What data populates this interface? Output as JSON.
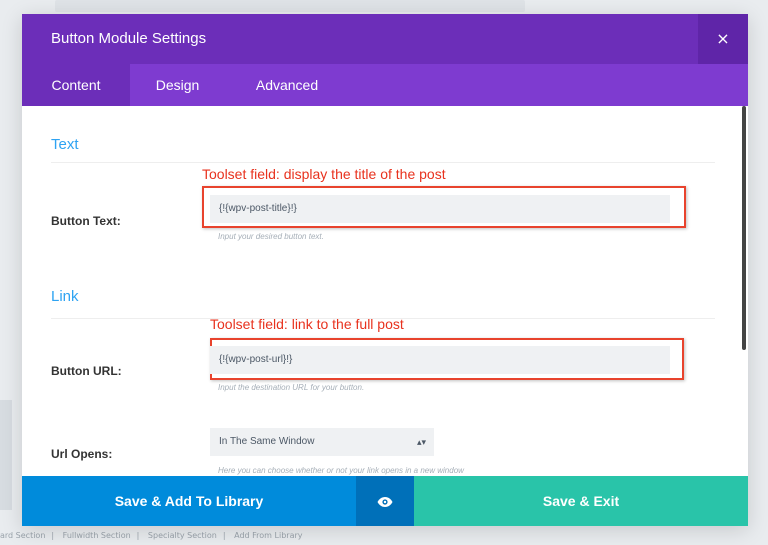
{
  "modal": {
    "title": "Button Module Settings",
    "close_symbol": "×",
    "tabs": [
      {
        "label": "Content",
        "active": true
      },
      {
        "label": "Design",
        "active": false
      },
      {
        "label": "Advanced",
        "active": false
      }
    ]
  },
  "text_section": {
    "title": "Text",
    "annotation": "Toolset field: display the title of the post",
    "button_text_label": "Button Text:",
    "button_text_value": "{!{wpv-post-title}!}",
    "button_text_hint": "Input your desired button text."
  },
  "link_section": {
    "title": "Link",
    "annotation": "Toolset field: link to the full post",
    "button_url_label": "Button URL:",
    "button_url_value": "{!{wpv-post-url}!}",
    "button_url_hint": "Input the destination URL for your button.",
    "url_opens_label": "Url Opens:",
    "url_opens_value": "In The Same Window",
    "url_opens_hint": "Here you can choose whether or not your link opens in a new window"
  },
  "footer": {
    "save_library_label": "Save & Add To Library",
    "preview_icon": "eye-icon",
    "save_exit_label": "Save & Exit"
  },
  "colors": {
    "header": "#6c2eb9",
    "tabs": "#7e3bd0",
    "accent_blue": "#2ea3f2",
    "annotation_red": "#e8432d",
    "save_library": "#008bdb",
    "save_exit": "#29c4a9"
  },
  "background_page": {
    "footer_links": [
      "ard Section",
      "Fullwidth Section",
      "Specialty Section",
      "Add From Library"
    ]
  }
}
